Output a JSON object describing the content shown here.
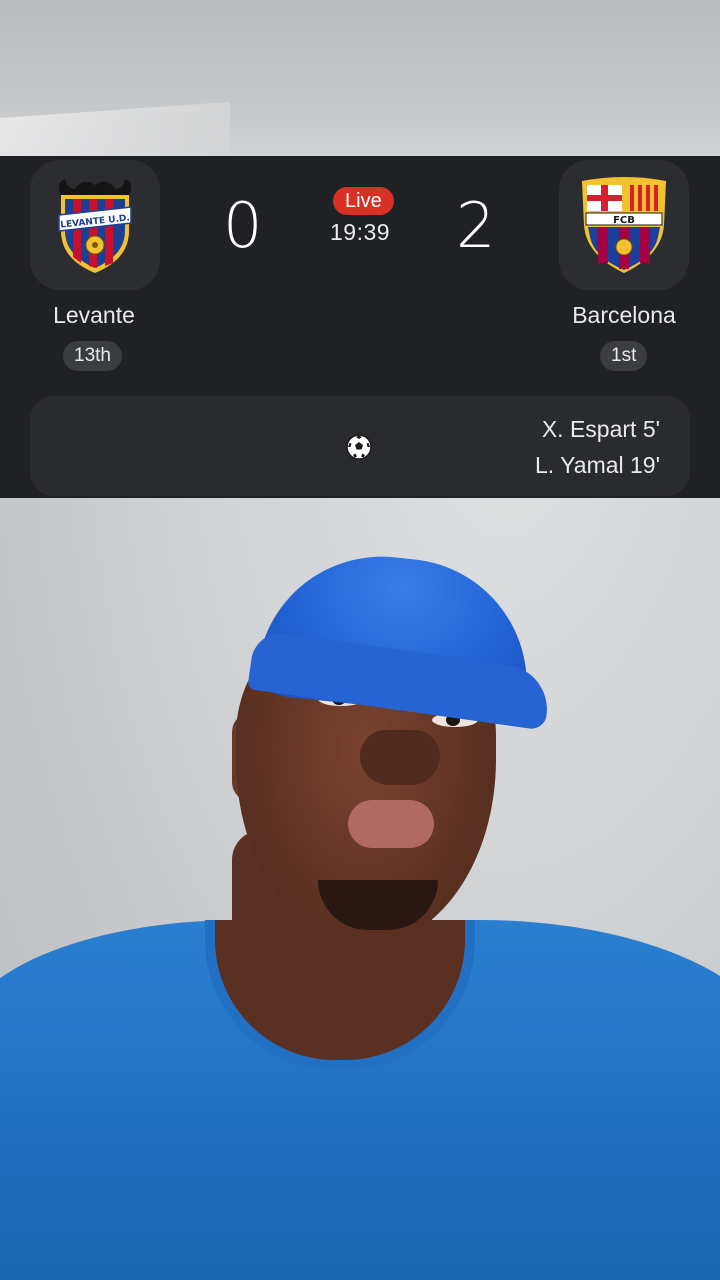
{
  "match": {
    "status": "Live",
    "clock": "19:39",
    "home": {
      "name": "Levante",
      "rank": "13th",
      "score": "0",
      "crest_icon": "levante-crest-icon"
    },
    "away": {
      "name": "Barcelona",
      "rank": "1st",
      "score": "2",
      "crest_icon": "barcelona-crest-icon",
      "crest_text": "FCB"
    },
    "events": {
      "icon": "soccer-ball-icon",
      "away_scorers": [
        "X. Espart 5'",
        "L. Yamal 19'"
      ]
    }
  },
  "colors": {
    "card_bg": "#202124",
    "live_red": "#d93025",
    "text": "#e8eaed"
  }
}
